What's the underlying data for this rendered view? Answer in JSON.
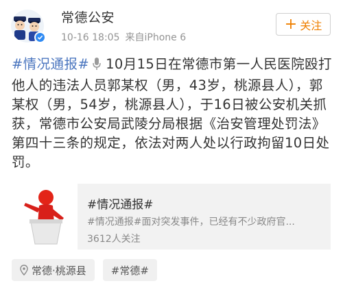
{
  "header": {
    "username": "常德公安",
    "time": "10-16 18:05",
    "source": "来自iPhone 6",
    "follow_label": "关注",
    "follow_plus": "+"
  },
  "post": {
    "hashtag": "#情况通报#",
    "body": "10月15日在常德市第一人民医院殴打他人的违法人员郭某权（男，43岁，桃源县人），郭某权（男，54岁，桃源县人），于16日被公安机关抓获，常德市公安局武陵分局根据《治安管理处罚法》第四十三条的规定，依法对两人处以行政拘留10日处罚。"
  },
  "card": {
    "title": "#情况通报#",
    "description": "#情况通报#面对突发事件，已经有不少政府官...",
    "followers": "3612人关注"
  },
  "tags": {
    "location": "常德·桃源县",
    "topic": "#常德#"
  },
  "colors": {
    "accent_orange": "#ef7f00",
    "link_blue": "#4b76bf",
    "verify_blue": "#2f8af3"
  },
  "icons": {
    "avatar": "police-cartoon-avatar",
    "verify": "verified-badge-icon",
    "voice": "microphone-icon",
    "card_thumb": "speaker-at-podium-image",
    "location": "location-pin-icon"
  }
}
